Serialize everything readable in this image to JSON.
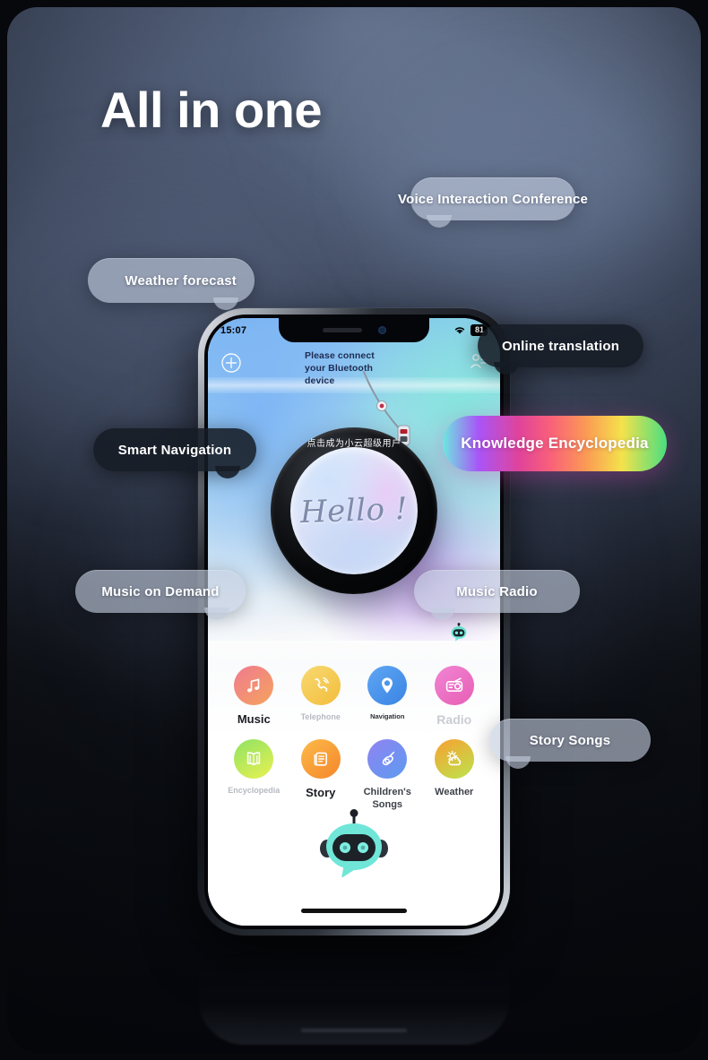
{
  "page": {
    "title": "All in one",
    "background_color": "#3a4458",
    "accent_color": "#6ee7e0"
  },
  "callouts": [
    {
      "id": "voice",
      "label": "Voice Interaction Conference",
      "style": "light"
    },
    {
      "id": "weather",
      "label": "Weather forecast",
      "style": "light"
    },
    {
      "id": "online",
      "label": "Online translation",
      "style": "dark"
    },
    {
      "id": "smartnav",
      "label": "Smart Navigation",
      "style": "dark"
    },
    {
      "id": "knowledge",
      "label": "Knowledge Encyclopedia",
      "style": "rainbow"
    },
    {
      "id": "musicdem",
      "label": "Music on Demand",
      "style": "light"
    },
    {
      "id": "musicradio",
      "label": "Music Radio",
      "style": "light"
    },
    {
      "id": "storysongs",
      "label": "Story Songs",
      "style": "light"
    }
  ],
  "phone": {
    "status_bar": {
      "time": "15:07",
      "wifi_icon": "wifi-icon",
      "battery_level": "81"
    },
    "app": {
      "add_icon": "plus-circle-icon",
      "profile_icon": "user-profile-icon",
      "bluetooth_hint": "Please connect your Bluetooth device",
      "ring_label": "点击成为小云超级用户",
      "hello_text": "Hello !",
      "mini_robot_icon": "robot-icon",
      "mascot_icon": "robot-mascot-icon",
      "grid": [
        {
          "id": "music",
          "label": "Music",
          "icon": "music-note-icon",
          "color_from": "#f07a8f",
          "color_to": "#f5a35f",
          "label_style": "lbl-strong"
        },
        {
          "id": "telephone",
          "label": "Telephone",
          "icon": "phone-call-icon",
          "color_from": "#f7d15e",
          "color_to": "#f5c24a",
          "label_style": "lbl-faint"
        },
        {
          "id": "navigation",
          "label": "Navigation",
          "icon": "map-pin-icon",
          "color_from": "#4f9cf0",
          "color_to": "#3f8ae8",
          "label_style": "lbl-tiny"
        },
        {
          "id": "radio",
          "label": "Radio",
          "icon": "radio-icon",
          "color_from": "#ef72c8",
          "color_to": "#e95fb6",
          "label_style": "lbl-ghost"
        },
        {
          "id": "encyclopedia",
          "label": "Encyclopedia",
          "icon": "open-book-icon",
          "color_from": "#8ae05f",
          "color_to": "#e8f04f",
          "label_style": "lbl-faint"
        },
        {
          "id": "story",
          "label": "Story",
          "icon": "document-icon",
          "color_from": "#fbb03b",
          "color_to": "#f78b2e",
          "label_style": "lbl-strong"
        },
        {
          "id": "childsongs",
          "label": "Children's Songs",
          "icon": "guitar-icon",
          "color_from": "#8b7df0",
          "color_to": "#5b9bf0",
          "label_style": "lbl-mid"
        },
        {
          "id": "weather",
          "label": "Weather",
          "icon": "sun-cloud-icon",
          "color_from": "#f79a2e",
          "color_to": "#b6e24a",
          "label_style": "lbl-mid"
        }
      ]
    }
  }
}
